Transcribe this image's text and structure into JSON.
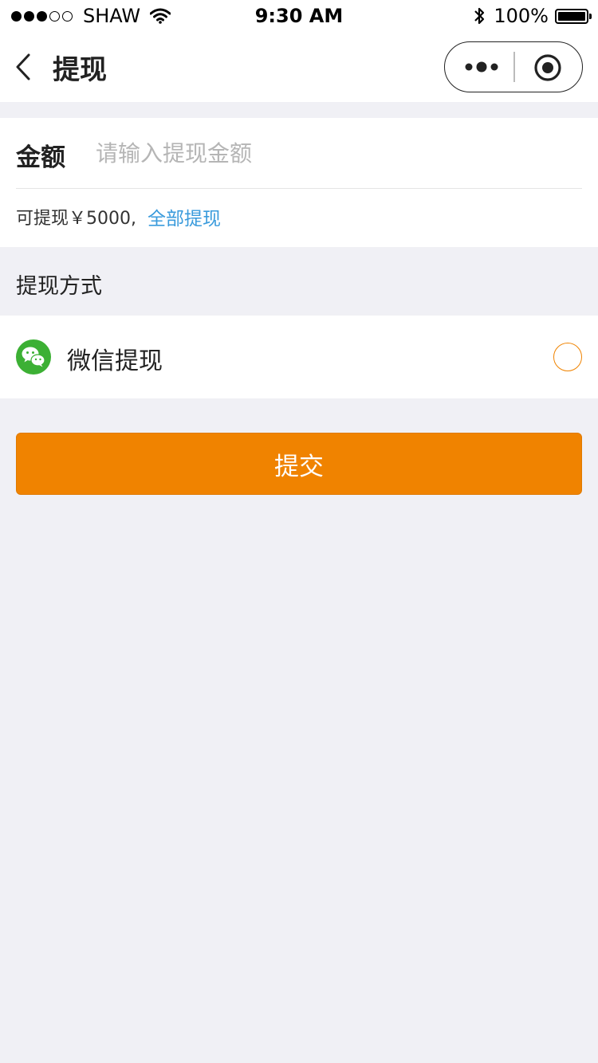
{
  "status_bar": {
    "carrier": "SHAW",
    "time": "9:30 AM",
    "battery": "100%",
    "signal_bars_filled": 3,
    "signal_bars_total": 5
  },
  "nav": {
    "title": "提现"
  },
  "amount": {
    "label": "金额",
    "placeholder": "请输入提现金额",
    "value": "",
    "available_text": "可提现￥5000,",
    "withdraw_all_label": "全部提现"
  },
  "method": {
    "section_title": "提现方式",
    "options": [
      {
        "label": "微信提现",
        "icon": "wechat-icon",
        "selected": false
      }
    ]
  },
  "submit": {
    "label": "提交"
  },
  "colors": {
    "accent": "#f08300",
    "link": "#3a9bdc",
    "wechat_green": "#3cb034",
    "background": "#f0f0f5"
  }
}
